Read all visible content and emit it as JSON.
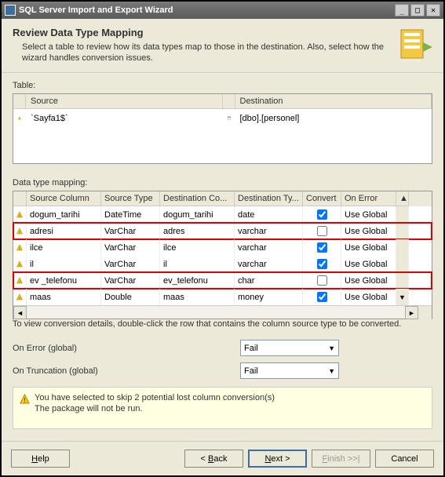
{
  "titlebar": {
    "text": "SQL Server Import and Export Wizard"
  },
  "header": {
    "title": "Review Data Type Mapping",
    "desc": "Select a table to review how its data types map to those in the destination. Also, select how the wizard handles conversion issues."
  },
  "table_section": {
    "label": "Table:",
    "headers": {
      "source": "Source",
      "destination": "Destination"
    },
    "row": {
      "source": "`Sayfa1$`",
      "destination": "[dbo].[personel]"
    }
  },
  "mapping_section": {
    "label": "Data type mapping:",
    "headers": {
      "source_col": "Source Column",
      "source_type": "Source Type",
      "dest_col": "Destination Co...",
      "dest_type": "Destination Ty...",
      "convert": "Convert",
      "on_error": "On Error"
    },
    "rows": [
      {
        "source_col": "dogum_tarihi",
        "source_type": "DateTime",
        "dest_col": "dogum_tarihi",
        "dest_type": "date",
        "convert": true,
        "on_error": "Use Global",
        "hl": false
      },
      {
        "source_col": "adresi",
        "source_type": "VarChar",
        "dest_col": "adres",
        "dest_type": "varchar",
        "convert": false,
        "on_error": "Use Global",
        "hl": true
      },
      {
        "source_col": "ilce",
        "source_type": "VarChar",
        "dest_col": "ilce",
        "dest_type": "varchar",
        "convert": true,
        "on_error": "Use Global",
        "hl": false
      },
      {
        "source_col": "il",
        "source_type": "VarChar",
        "dest_col": "il",
        "dest_type": "varchar",
        "convert": true,
        "on_error": "Use Global",
        "hl": false
      },
      {
        "source_col": "ev _telefonu",
        "source_type": "VarChar",
        "dest_col": "ev_telefonu",
        "dest_type": "char",
        "convert": false,
        "on_error": "Use Global",
        "hl": true
      },
      {
        "source_col": "maas",
        "source_type": "Double",
        "dest_col": "maas",
        "dest_type": "money",
        "convert": true,
        "on_error": "Use Global",
        "hl": false
      }
    ],
    "note": "To view conversion details, double-click the row that contains the column source type to be converted."
  },
  "globals": {
    "on_error_label": "On Error (global)",
    "on_error_value": "Fail",
    "on_trunc_label": "On Truncation (global)",
    "on_trunc_value": "Fail"
  },
  "info": {
    "line1": "You have selected to skip 2 potential lost column conversion(s)",
    "line2": "The package will not be run."
  },
  "buttons": {
    "help": "Help",
    "back": "< Back",
    "next": "Next >",
    "finish": "Finish >>|",
    "cancel": "Cancel"
  }
}
